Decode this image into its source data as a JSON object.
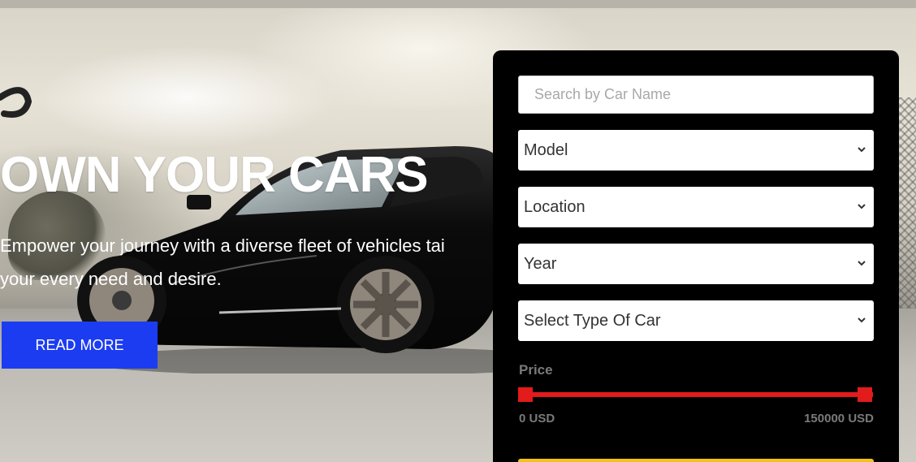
{
  "hero": {
    "title": "OWN YOUR CARS",
    "text_line1": "Empower your journey with a diverse fleet of vehicles tai",
    "text_line2": "your every need and desire.",
    "read_more_label": "READ MORE"
  },
  "search_panel": {
    "search_placeholder": "Search by Car Name",
    "selects": {
      "model": "Model",
      "location": "Location",
      "year": "Year",
      "type": "Select Type Of Car"
    },
    "price": {
      "label": "Price",
      "min_label": "0 USD",
      "max_label": "150000 USD",
      "min_value": 0,
      "max_value": 150000
    }
  },
  "colors": {
    "accent_blue": "#1c3cf2",
    "slider_red": "#e21b1b",
    "button_yellow": "#f3c21c",
    "panel_bg": "#000000"
  },
  "icons": [
    "chevron-down-icon"
  ]
}
